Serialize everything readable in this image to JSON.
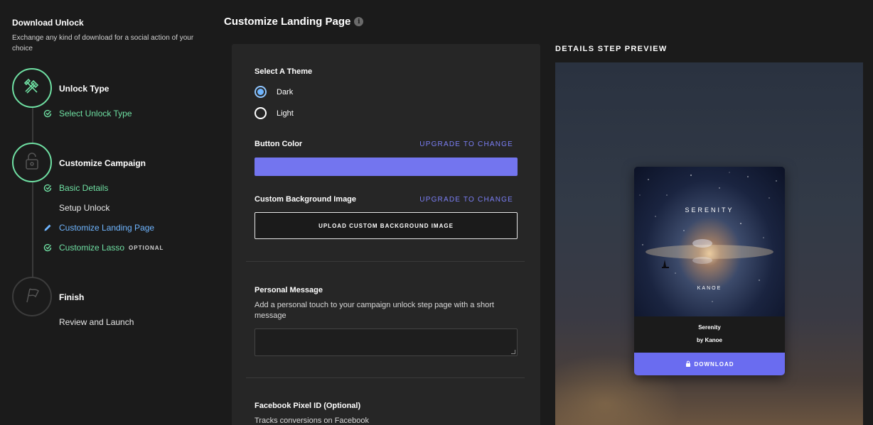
{
  "sidebar": {
    "title": "Download Unlock",
    "description": "Exchange any kind of download for a social action of your choice",
    "steps": [
      {
        "title": "Unlock Type",
        "icon": "tools-icon",
        "active": true,
        "items": [
          {
            "label": "Select Unlock Type",
            "state": "done"
          }
        ]
      },
      {
        "title": "Customize Campaign",
        "icon": "lock-icon",
        "active": true,
        "items": [
          {
            "label": "Basic Details",
            "state": "done"
          },
          {
            "label": "Setup Unlock",
            "state": "pending"
          },
          {
            "label": "Customize Landing Page",
            "state": "current"
          },
          {
            "label": "Customize Lasso",
            "state": "done",
            "badge": "OPTIONAL"
          }
        ]
      },
      {
        "title": "Finish",
        "icon": "flag-icon",
        "active": false,
        "items": [
          {
            "label": "Review and Launch",
            "state": "pending"
          }
        ]
      }
    ]
  },
  "main": {
    "title": "Customize Landing Page",
    "theme": {
      "label": "Select A Theme",
      "options": [
        "Dark",
        "Light"
      ],
      "selected": "Dark"
    },
    "button_color": {
      "label": "Button Color",
      "upgrade": "UPGRADE TO CHANGE",
      "value": "#7375ef"
    },
    "background": {
      "label": "Custom Background Image",
      "upgrade": "UPGRADE TO CHANGE",
      "button": "UPLOAD CUSTOM BACKGROUND IMAGE"
    },
    "message": {
      "label": "Personal Message",
      "help": "Add a personal touch to your campaign unlock step page with a short message",
      "value": ""
    },
    "pixel": {
      "label": "Facebook Pixel ID (Optional)",
      "help": "Tracks conversions on Facebook"
    }
  },
  "preview": {
    "title": "DETAILS STEP PREVIEW",
    "art_title": "SERENITY",
    "art_artist": "KANOE",
    "track_name": "Serenity",
    "track_by": "by Kanoe",
    "download_label": "DOWNLOAD",
    "button_color": "#6a6cf0"
  },
  "colors": {
    "accent_green": "#6fe0a3",
    "accent_blue": "#6fb5ff",
    "upgrade_purple": "#7b7ff5"
  }
}
